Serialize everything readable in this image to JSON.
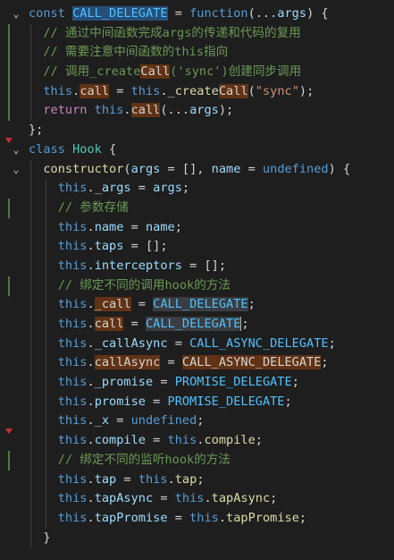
{
  "theme": {
    "background": "#1e1e1e",
    "keyword": "#569cd6",
    "class_name": "#4ec9b0",
    "constant": "#4fc1ff",
    "variable": "#9cdcfe",
    "function": "#dcdcaa",
    "string": "#ce9178",
    "comment": "#6a9955",
    "text": "#d4d4d4",
    "highlight": "#613214",
    "git_change": "#4e7a3d",
    "breakpoint": "#c4332e"
  },
  "code": {
    "l1": {
      "t1": "const ",
      "t2": "CALL_DELEGATE",
      "t3": " = ",
      "t4": "function",
      "t5": "(...",
      "t6": "args",
      "t7": ") {"
    },
    "l2": {
      "t1": "// 通过中间函数完成args的传递和代码的复用"
    },
    "l3": {
      "t1": "// 需要注意中间函数的this指向"
    },
    "l4": {
      "t1": "// 调用_create",
      "t2": "Call",
      "t3": "('sync')创建同步调用"
    },
    "l5": {
      "t1": "this",
      "t2": ".",
      "t3": "call",
      "t4": " = ",
      "t5": "this",
      "t6": "._create",
      "t7": "Call",
      "t8": "(",
      "t9": "\"sync\"",
      "t10": ");"
    },
    "l6": {
      "t1": "return ",
      "t2": "this",
      "t3": ".",
      "t4": "call",
      "t5": "(...",
      "t6": "args",
      "t7": ");"
    },
    "l7": {
      "t1": "};"
    },
    "l8": {
      "t1": "class ",
      "t2": "Hook",
      "t3": " {"
    },
    "l9": {
      "t1": "constructor",
      "t2": "(",
      "t3": "args",
      "t4": " = [], ",
      "t5": "name",
      "t6": " = ",
      "t7": "undefined",
      "t8": ") {"
    },
    "l10": {
      "t1": "this",
      "t2": ".",
      "t3": "_args",
      "t4": " = ",
      "t5": "args",
      "t6": ";"
    },
    "l11": {
      "t1": "// 参数存储"
    },
    "l12": {
      "t1": "this",
      "t2": ".",
      "t3": "name",
      "t4": " = ",
      "t5": "name",
      "t6": ";"
    },
    "l13": {
      "t1": "this",
      "t2": ".",
      "t3": "taps",
      "t4": " = [];"
    },
    "l14": {
      "t1": "this",
      "t2": ".",
      "t3": "interceptors",
      "t4": " = [];"
    },
    "l15": {
      "t1": "// 绑定不同的调用hook的方法"
    },
    "l16": {
      "t1": "this",
      "t2": ".",
      "t3": "_call",
      "t4": " = ",
      "t5": "CALL_DELEGATE",
      "t6": ";"
    },
    "l17": {
      "t1": "this",
      "t2": ".",
      "t3": "call",
      "t4": " = ",
      "t5": "CALL_DELEGATE",
      "t6": ";"
    },
    "l18": {
      "t1": "this",
      "t2": ".",
      "t3": "_callAsync",
      "t4": " = ",
      "t5": "CALL_ASYNC_DELEGATE",
      "t6": ";"
    },
    "l19": {
      "t1": "this",
      "t2": ".",
      "t3": "callAsync",
      "t4": " = ",
      "t5": "CALL_ASYNC_DELEGATE",
      "t6": ";"
    },
    "l20": {
      "t1": "this",
      "t2": ".",
      "t3": "_promise",
      "t4": " = ",
      "t5": "PROMISE_DELEGATE",
      "t6": ";"
    },
    "l21": {
      "t1": "this",
      "t2": ".",
      "t3": "promise",
      "t4": " = ",
      "t5": "PROMISE_DELEGATE",
      "t6": ";"
    },
    "l22": {
      "t1": "this",
      "t2": ".",
      "t3": "_x",
      "t4": " = ",
      "t5": "undefined",
      "t6": ";"
    },
    "l23": {
      "t1": "this",
      "t2": ".",
      "t3": "compile",
      "t4": " = ",
      "t5": "this",
      "t6": ".",
      "t7": "compile",
      "t8": ";"
    },
    "l24": {
      "t1": "// 绑定不同的监听hook的方法"
    },
    "l25": {
      "t1": "this",
      "t2": ".",
      "t3": "tap",
      "t4": " = ",
      "t5": "this",
      "t6": ".",
      "t7": "tap",
      "t8": ";"
    },
    "l26": {
      "t1": "this",
      "t2": ".",
      "t3": "tapAsync",
      "t4": " = ",
      "t5": "this",
      "t6": ".",
      "t7": "tapAsync",
      "t8": ";"
    },
    "l27": {
      "t1": "this",
      "t2": ".",
      "t3": "tapPromise",
      "t4": " = ",
      "t5": "this",
      "t6": ".",
      "t7": "tapPromise",
      "t8": ";"
    },
    "l28": {
      "t1": "}"
    }
  }
}
